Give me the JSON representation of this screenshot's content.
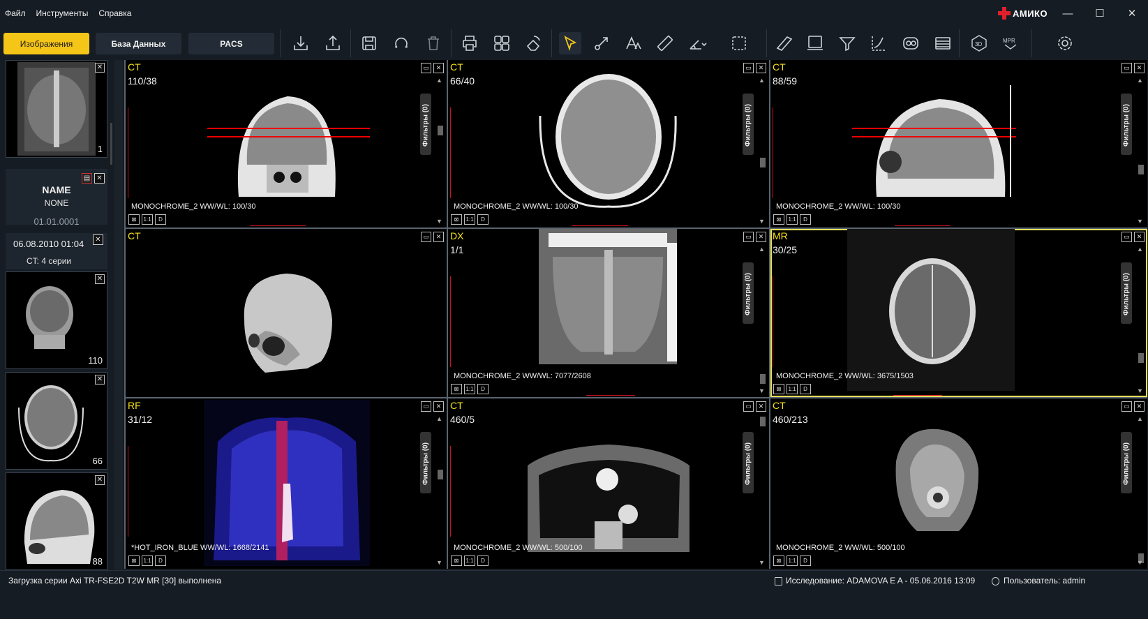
{
  "menu": [
    "Файл",
    "Инструменты",
    "Справка"
  ],
  "brand": {
    "name": "АМИКО",
    "accent": "#e0202a"
  },
  "window_controls": [
    "—",
    "☐",
    "✕"
  ],
  "tabs": [
    {
      "label": "Изображения",
      "active": true
    },
    {
      "label": "База Данных",
      "active": false
    },
    {
      "label": "PACS",
      "active": false
    }
  ],
  "toolbar_icons": [
    "import-icon",
    "export-icon",
    "save-icon",
    "rotate-icon",
    "trash-icon",
    "print-icon",
    "layout-grid-icon",
    "rotate-free-icon",
    "pointer-icon",
    "arrow-tool-icon",
    "text-annotation-icon",
    "ruler-icon",
    "angle-icon",
    "selection-icon",
    "magic-wand-icon",
    "frame-icon",
    "filter-icon",
    "curve-icon",
    "link-icon",
    "clapper-icon",
    "list-icon",
    "3d-icon",
    "mpr-icon",
    "settings-icon"
  ],
  "left": {
    "thumb_top_num": "1",
    "patient_name": "NAME",
    "patient_id": "NONE",
    "birth_date": "01.01.0001",
    "study_date": "06.08.2010 01:04",
    "study_info": "CT: 4 серии",
    "thumbs": [
      {
        "num": "110"
      },
      {
        "num": "66"
      },
      {
        "num": "88"
      }
    ]
  },
  "viewports": [
    {
      "modality": "CT",
      "count": "110/38",
      "wwwl": "MONOCHROME_2 WW/WL: 100/30",
      "filter": "Фильтры (0)"
    },
    {
      "modality": "CT",
      "count": "66/40",
      "wwwl": "MONOCHROME_2 WW/WL: 100/30",
      "filter": "Фильтры (0)"
    },
    {
      "modality": "CT",
      "count": "88/59",
      "wwwl": "MONOCHROME_2 WW/WL: 100/30",
      "filter": "Фильтры (0)"
    },
    {
      "modality": "CT",
      "count": "",
      "wwwl": "",
      "filter": ""
    },
    {
      "modality": "DX",
      "count": "1/1",
      "wwwl": "MONOCHROME_2 WW/WL: 7077/2608",
      "filter": "Фильтры (0)"
    },
    {
      "modality": "MR",
      "count": "30/25",
      "wwwl": "MONOCHROME_2 WW/WL: 3675/1503",
      "filter": "Фильтры (0)"
    },
    {
      "modality": "RF",
      "count": "31/12",
      "wwwl": "*HOT_IRON_BLUE WW/WL: 1668/2141",
      "filter": "Фильтры (0)"
    },
    {
      "modality": "CT",
      "count": "460/5",
      "wwwl": "MONOCHROME_2 WW/WL: 500/100",
      "filter": "Фильтры (0)"
    },
    {
      "modality": "CT",
      "count": "460/213",
      "wwwl": "MONOCHROME_2 WW/WL: 500/100",
      "filter": "Фильтры (0)"
    }
  ],
  "vp_buttons": [
    "⊠",
    "1:1",
    "D"
  ],
  "status": {
    "message": "Загрузка серии Axi TR-FSE2D T2W MR [30] выполнена",
    "study": "Исследование: ADAMOVA E A - 05.06.2016 13:09",
    "user": "Пользователь: admin"
  },
  "colors": {
    "accent": "#f5c518",
    "modality_text": "#f5e11a",
    "active_border": "#e6e05a",
    "ruler": "#cc1122"
  }
}
